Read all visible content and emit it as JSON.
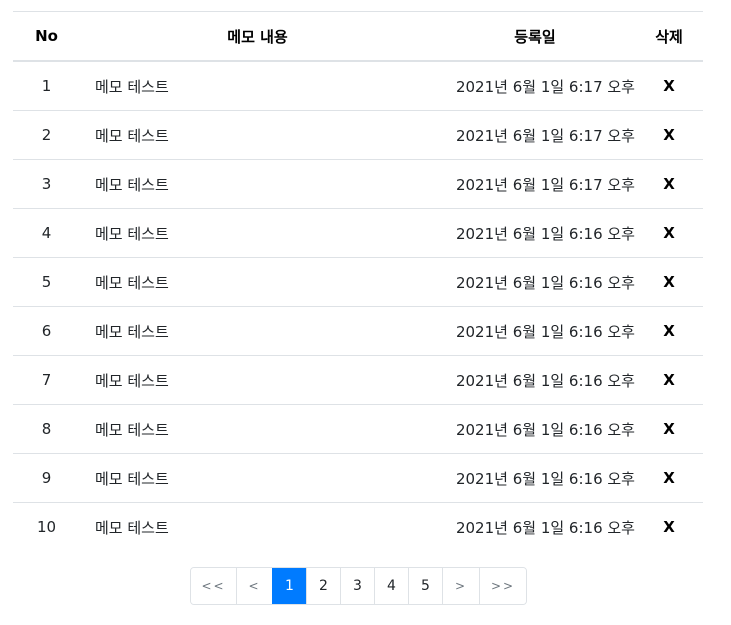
{
  "table": {
    "headers": {
      "no": "No",
      "content": "메모 내용",
      "date": "등록일",
      "delete": "삭제"
    },
    "rows": [
      {
        "no": "1",
        "content": "메모 테스트",
        "date": "2021년 6월 1일 6:17 오후",
        "delete": "X"
      },
      {
        "no": "2",
        "content": "메모 테스트",
        "date": "2021년 6월 1일 6:17 오후",
        "delete": "X"
      },
      {
        "no": "3",
        "content": "메모 테스트",
        "date": "2021년 6월 1일 6:17 오후",
        "delete": "X"
      },
      {
        "no": "4",
        "content": "메모 테스트",
        "date": "2021년 6월 1일 6:16 오후",
        "delete": "X"
      },
      {
        "no": "5",
        "content": "메모 테스트",
        "date": "2021년 6월 1일 6:16 오후",
        "delete": "X"
      },
      {
        "no": "6",
        "content": "메모 테스트",
        "date": "2021년 6월 1일 6:16 오후",
        "delete": "X"
      },
      {
        "no": "7",
        "content": "메모 테스트",
        "date": "2021년 6월 1일 6:16 오후",
        "delete": "X"
      },
      {
        "no": "8",
        "content": "메모 테스트",
        "date": "2021년 6월 1일 6:16 오후",
        "delete": "X"
      },
      {
        "no": "9",
        "content": "메모 테스트",
        "date": "2021년 6월 1일 6:16 오후",
        "delete": "X"
      },
      {
        "no": "10",
        "content": "메모 테스트",
        "date": "2021년 6월 1일 6:16 오후",
        "delete": "X"
      }
    ]
  },
  "pagination": {
    "first": "<<",
    "prev": "<",
    "pages": [
      "1",
      "2",
      "3",
      "4",
      "5"
    ],
    "active_page": "1",
    "next": ">",
    "last": ">>"
  },
  "colors": {
    "active_page_bg": "#007bff",
    "border": "#dee2e6"
  }
}
